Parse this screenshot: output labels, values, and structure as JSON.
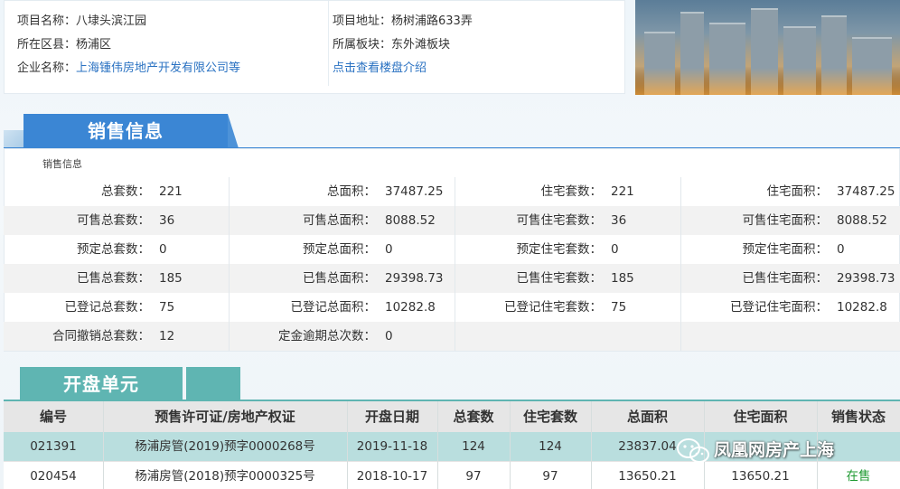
{
  "project_info": {
    "name_label": "项目名称：",
    "name_value": "八埭头滨江园",
    "district_label": "所在区县：",
    "district_value": "杨浦区",
    "company_label": "企业名称：",
    "company_value": "上海锺伟房地产开发有限公司等",
    "address_label": "项目地址：",
    "address_value": "杨树浦路633弄",
    "block_label": "所属板块：",
    "block_value": "东外滩板块",
    "intro_link": "点击查看楼盘介绍"
  },
  "sales_section": {
    "title": "销售信息",
    "subtitle": "销售信息",
    "rows": [
      [
        {
          "label": "总套数：",
          "value": "221"
        },
        {
          "label": "总面积：",
          "value": "37487.25"
        },
        {
          "label": "住宅套数：",
          "value": "221"
        },
        {
          "label": "住宅面积：",
          "value": "37487.25"
        }
      ],
      [
        {
          "label": "可售总套数：",
          "value": "36"
        },
        {
          "label": "可售总面积：",
          "value": "8088.52"
        },
        {
          "label": "可售住宅套数：",
          "value": "36"
        },
        {
          "label": "可售住宅面积：",
          "value": "8088.52"
        }
      ],
      [
        {
          "label": "预定总套数：",
          "value": "0"
        },
        {
          "label": "预定总面积：",
          "value": "0"
        },
        {
          "label": "预定住宅套数：",
          "value": "0"
        },
        {
          "label": "预定住宅面积：",
          "value": "0"
        }
      ],
      [
        {
          "label": "已售总套数：",
          "value": "185"
        },
        {
          "label": "已售总面积：",
          "value": "29398.73"
        },
        {
          "label": "已售住宅套数：",
          "value": "185"
        },
        {
          "label": "已售住宅面积：",
          "value": "29398.73"
        }
      ],
      [
        {
          "label": "已登记总套数：",
          "value": "75"
        },
        {
          "label": "已登记总面积：",
          "value": "10282.8"
        },
        {
          "label": "已登记住宅套数：",
          "value": "75"
        },
        {
          "label": "已登记住宅面积：",
          "value": "10282.8"
        }
      ],
      [
        {
          "label": "合同撤销总套数：",
          "value": "12"
        },
        {
          "label": "定金逾期总次数：",
          "value": "0"
        },
        {
          "label": "",
          "value": ""
        },
        {
          "label": "",
          "value": ""
        }
      ]
    ]
  },
  "units_section": {
    "title": "开盘单元",
    "headers": [
      "编号",
      "预售许可证/房地产权证",
      "开盘日期",
      "总套数",
      "住宅套数",
      "总面积",
      "住宅面积",
      "销售状态"
    ],
    "rows": [
      [
        "021391",
        "杨浦房管(2019)预字0000268号",
        "2019-11-18",
        "124",
        "124",
        "23837.04",
        "",
        ""
      ],
      [
        "020454",
        "杨浦房管(2018)预字0000325号",
        "2018-10-17",
        "97",
        "97",
        "13650.21",
        "13650.21",
        "在售"
      ]
    ]
  },
  "watermark": {
    "text": "凤凰网房产上海",
    "icon": "wechat-icon"
  },
  "colors": {
    "sales_tab": "#3b86d4",
    "units_tab": "#5fb5b2",
    "link": "#2a72c2",
    "status_on_sale": "#1f9a32",
    "row_highlight": "#b9dede"
  }
}
